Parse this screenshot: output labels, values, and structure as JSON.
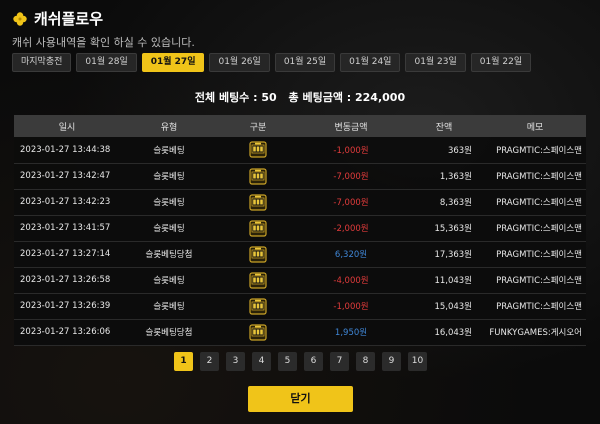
{
  "header": {
    "title": "캐쉬플로우",
    "subtitle": "캐쉬 사용내역을 확인 하실 수 있습니다."
  },
  "tabs": [
    {
      "label": "마지막충전",
      "active": false
    },
    {
      "label": "01월 28일",
      "active": false
    },
    {
      "label": "01월 27일",
      "active": true
    },
    {
      "label": "01월 26일",
      "active": false
    },
    {
      "label": "01월 25일",
      "active": false
    },
    {
      "label": "01월 24일",
      "active": false
    },
    {
      "label": "01월 23일",
      "active": false
    },
    {
      "label": "01월 22일",
      "active": false
    }
  ],
  "summary": {
    "bet_count_label": "전체 베팅수 : 50",
    "bet_amount_label": "총 베팅금액 : 224,000"
  },
  "table": {
    "headers": [
      "일시",
      "유형",
      "구분",
      "변동금액",
      "잔액",
      "메모"
    ],
    "rows": [
      {
        "date": "2023-01-27 13:44:38",
        "type": "슬롯베팅",
        "change": "-1,000원",
        "sign": "neg",
        "balance": "363원",
        "memo": "PRAGMTIC:스페이스맨"
      },
      {
        "date": "2023-01-27 13:42:47",
        "type": "슬롯베팅",
        "change": "-7,000원",
        "sign": "neg",
        "balance": "1,363원",
        "memo": "PRAGMTIC:스페이스맨"
      },
      {
        "date": "2023-01-27 13:42:23",
        "type": "슬롯베팅",
        "change": "-7,000원",
        "sign": "neg",
        "balance": "8,363원",
        "memo": "PRAGMTIC:스페이스맨"
      },
      {
        "date": "2023-01-27 13:41:57",
        "type": "슬롯베팅",
        "change": "-2,000원",
        "sign": "neg",
        "balance": "15,363원",
        "memo": "PRAGMTIC:스페이스맨"
      },
      {
        "date": "2023-01-27 13:27:14",
        "type": "슬롯베팅당첨",
        "change": "6,320원",
        "sign": "pos",
        "balance": "17,363원",
        "memo": "PRAGMTIC:스페이스맨"
      },
      {
        "date": "2023-01-27 13:26:58",
        "type": "슬롯베팅",
        "change": "-4,000원",
        "sign": "neg",
        "balance": "11,043원",
        "memo": "PRAGMTIC:스페이스맨"
      },
      {
        "date": "2023-01-27 13:26:39",
        "type": "슬롯베팅",
        "change": "-1,000원",
        "sign": "neg",
        "balance": "15,043원",
        "memo": "PRAGMTIC:스페이스맨"
      },
      {
        "date": "2023-01-27 13:26:06",
        "type": "슬롯베팅당첨",
        "change": "1,950원",
        "sign": "pos",
        "balance": "16,043원",
        "memo": "FUNKYGAMES:게시오어"
      }
    ],
    "category_icon": "slot-machine-icon"
  },
  "pagination": {
    "pages": [
      "1",
      "2",
      "3",
      "4",
      "5",
      "6",
      "7",
      "8",
      "9",
      "10"
    ],
    "current": "1"
  },
  "close_label": "닫기",
  "colors": {
    "accent": "#f0c419",
    "negative": "#e03b3b",
    "positive": "#3f86d6"
  }
}
